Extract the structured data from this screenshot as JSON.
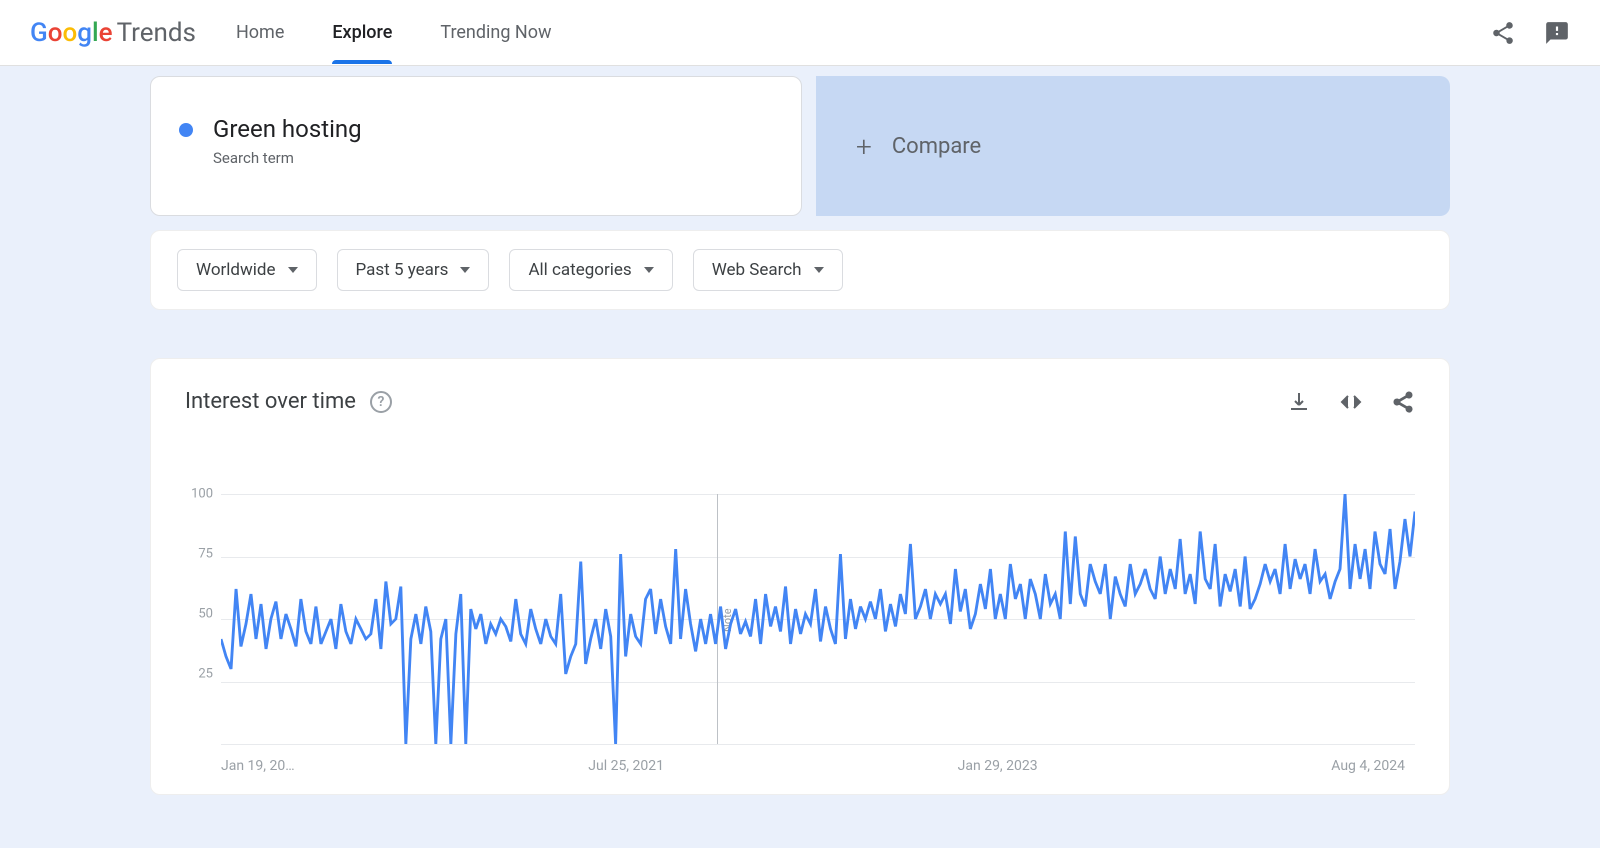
{
  "logo": {
    "text": "Google",
    "suffix": "Trends"
  },
  "nav": {
    "items": [
      "Home",
      "Explore",
      "Trending Now"
    ],
    "active": "Explore"
  },
  "term": {
    "name": "Green hosting",
    "type": "Search term"
  },
  "compare": {
    "label": "Compare"
  },
  "filters": {
    "region": "Worldwide",
    "time": "Past 5 years",
    "category": "All categories",
    "search_type": "Web Search"
  },
  "chart": {
    "title": "Interest over time",
    "note": "Note",
    "x_ticks": [
      "Jan 19, 20…",
      "Jul 25, 2021",
      "Jan 29, 2023",
      "Aug 4, 2024"
    ]
  },
  "chart_data": {
    "type": "line",
    "title": "Interest over time",
    "xlabel": "",
    "ylabel": "",
    "ylim": [
      0,
      100
    ],
    "y_ticks": [
      25,
      50,
      75,
      100
    ],
    "x_tick_labels": [
      "Jan 19, 20…",
      "Jul 25, 2021",
      "Jan 29, 2023",
      "Aug 4, 2024"
    ],
    "series": [
      {
        "name": "Green hosting",
        "color": "#4285F4",
        "values": [
          42,
          35,
          30,
          62,
          39,
          48,
          60,
          42,
          56,
          38,
          50,
          57,
          42,
          52,
          46,
          39,
          58,
          45,
          40,
          55,
          40,
          45,
          50,
          38,
          56,
          45,
          40,
          50,
          46,
          42,
          44,
          58,
          38,
          65,
          48,
          50,
          63,
          0,
          42,
          52,
          40,
          55,
          45,
          0,
          42,
          50,
          0,
          44,
          60,
          0,
          54,
          46,
          52,
          40,
          48,
          44,
          50,
          47,
          41,
          58,
          44,
          40,
          54,
          46,
          40,
          50,
          43,
          40,
          60,
          28,
          35,
          40,
          73,
          32,
          42,
          50,
          38,
          54,
          43,
          0,
          76,
          35,
          52,
          43,
          40,
          58,
          62,
          44,
          58,
          47,
          40,
          78,
          42,
          62,
          48,
          37,
          50,
          40,
          52,
          40,
          55,
          38,
          48,
          54,
          44,
          49,
          43,
          58,
          40,
          60,
          47,
          55,
          45,
          63,
          40,
          54,
          44,
          52,
          48,
          62,
          41,
          55,
          46,
          40,
          76,
          42,
          58,
          46,
          55,
          50,
          57,
          50,
          62,
          45,
          56,
          47,
          60,
          52,
          80,
          50,
          55,
          62,
          50,
          60,
          56,
          60,
          48,
          70,
          53,
          62,
          46,
          52,
          64,
          54,
          70,
          50,
          60,
          50,
          72,
          58,
          64,
          50,
          66,
          60,
          50,
          68,
          56,
          60,
          50,
          85,
          56,
          83,
          60,
          55,
          72,
          65,
          60,
          72,
          50,
          67,
          60,
          55,
          72,
          60,
          64,
          70,
          62,
          58,
          75,
          60,
          70,
          62,
          82,
          60,
          68,
          56,
          85,
          66,
          62,
          80,
          55,
          68,
          61,
          70,
          55,
          75,
          54,
          58,
          64,
          72,
          65,
          70,
          60,
          80,
          62,
          74,
          66,
          72,
          60,
          78,
          65,
          68,
          58,
          65,
          70,
          100,
          62,
          80,
          66,
          78,
          62,
          85,
          72,
          68,
          86,
          62,
          73,
          90,
          75,
          93
        ]
      }
    ]
  }
}
